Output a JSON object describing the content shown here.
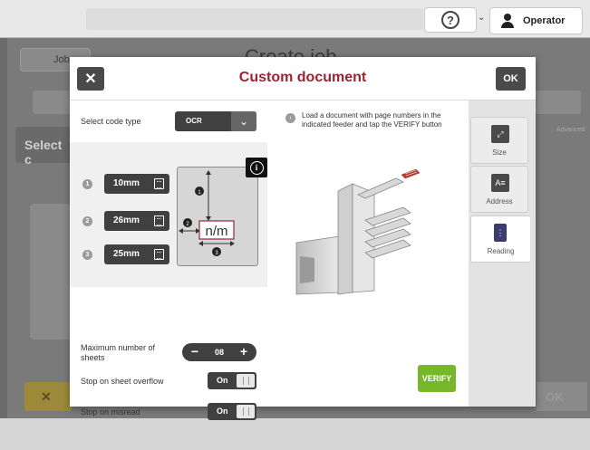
{
  "topbar": {
    "help_icon": "question-circle-icon",
    "user_label": "Operator"
  },
  "background": {
    "jobs_label": "Jobs",
    "page_title": "Create job",
    "select_label": "Select c",
    "cancel_label": "✕",
    "ok_label": "OK",
    "advanced_label": "Advanced"
  },
  "modal": {
    "title": "Custom document",
    "close_label": "✕",
    "ok_label": "OK",
    "title_color": "#9b2335"
  },
  "left": {
    "code_type_label": "Select code type",
    "code_type_value": "OCR",
    "fields": [
      {
        "index": "1",
        "value": "10mm"
      },
      {
        "index": "2",
        "value": "26mm"
      },
      {
        "index": "3",
        "value": "25mm"
      }
    ],
    "doc_sample_text": "n/m",
    "marker_labels": [
      "1",
      "2",
      "3"
    ],
    "max_sheets_label": "Maximum number of sheets",
    "max_sheets_value": "08",
    "overflow_label": "Stop on sheet overflow",
    "overflow_value": "On",
    "misread_label": "Stop on misread",
    "misread_value": "On"
  },
  "middle": {
    "instruction": "Load a document with page numbers in the indicated feeder and tap the VERIFY button",
    "verify_label": "VERIFY",
    "verify_color": "#76b82a"
  },
  "tabs": [
    {
      "label": "Size",
      "icon": "resize-icon",
      "active": false
    },
    {
      "label": "Address",
      "icon": "address-icon",
      "active": false
    },
    {
      "label": "Reading",
      "icon": "reading-icon",
      "active": true
    }
  ]
}
